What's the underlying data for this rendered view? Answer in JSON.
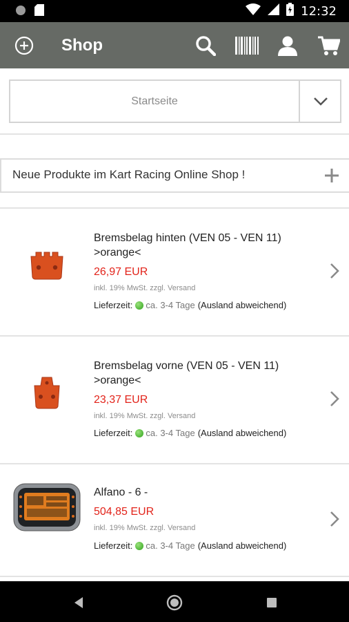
{
  "status_bar": {
    "time": "12:32"
  },
  "app_bar": {
    "title": "Shop"
  },
  "category_select": {
    "value": "Startseite"
  },
  "accordion": {
    "label": "Neue Produkte im Kart Racing Online Shop !"
  },
  "products": [
    {
      "name": "Bremsbelag hinten (VEN 05 - VEN 11) >orange<",
      "price": "26,97 EUR",
      "vat": "inkl. 19% MwSt. zzgl. Versand",
      "delivery_label": "Lieferzeit:",
      "delivery_time": "ca. 3-4 Tage",
      "delivery_note": "(Ausland abweichend)",
      "image": "rear-brake-pad-image"
    },
    {
      "name": "Bremsbelag vorne (VEN 05 - VEN 11) >orange<",
      "price": "23,37 EUR",
      "vat": "inkl. 19% MwSt. zzgl. Versand",
      "delivery_label": "Lieferzeit:",
      "delivery_time": "ca. 3-4 Tage",
      "delivery_note": "(Ausland abweichend)",
      "image": "front-brake-pad-image"
    },
    {
      "name": "Alfano - 6 -",
      "price": "504,85 EUR",
      "vat": "inkl. 19% MwSt. zzgl. Versand",
      "delivery_label": "Lieferzeit:",
      "delivery_time": "ca. 3-4 Tage",
      "delivery_note": "(Ausland abweichend)",
      "image": "lap-timer-device-image"
    }
  ],
  "colors": {
    "app_bar": "#666a65",
    "price": "#e2231a",
    "availability_green": "#2ea21a",
    "brake_pad_orange": "#d9501f"
  }
}
